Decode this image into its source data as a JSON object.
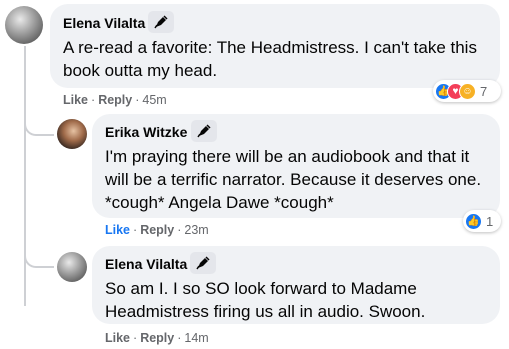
{
  "comments": [
    {
      "author": "Elena Vilalta",
      "text_lines": [
        "A re-read a favorite: The Headmistress. I can't take this",
        "book outta my head."
      ],
      "actions": {
        "like": "Like",
        "reply": "Reply",
        "time": "45m"
      },
      "reactions": {
        "count": "7",
        "icons": [
          "like-icon",
          "love-icon",
          "haha-icon"
        ]
      }
    },
    {
      "author": "Erika Witzke",
      "text_lines": [
        "I'm praying there will be an audiobook and that it",
        "will be a terrific narrator. Because it deserves one.",
        "*cough* Angela Dawe *cough*"
      ],
      "actions": {
        "like": "Like",
        "reply": "Reply",
        "time": "23m"
      },
      "reactions": {
        "count": "1",
        "icons": [
          "like-icon"
        ]
      }
    },
    {
      "author": "Elena Vilalta",
      "text_lines": [
        "So am I. I so SO look forward to Madame",
        "Headmistress firing us all in audio. Swoon."
      ],
      "actions": {
        "like": "Like",
        "reply": "Reply",
        "time": "14m"
      }
    }
  ],
  "separator": "·",
  "colors": {
    "bubble": "#f0f2f5",
    "like": "#1877f2",
    "love": "#f33e58",
    "haha": "#f7b125",
    "meta": "#65676b"
  }
}
